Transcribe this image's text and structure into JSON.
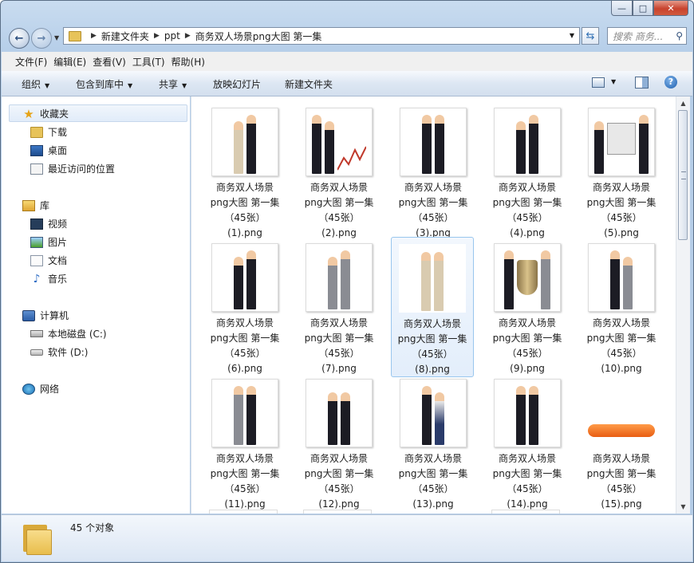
{
  "window": {
    "caption_buttons": {
      "minimize": "—",
      "maximize": "□",
      "close": "✕"
    }
  },
  "address": {
    "crumbs": [
      "新建文件夹",
      "ppt",
      "商务双人场景png大图 第一集"
    ],
    "search_placeholder": "搜索 商务..."
  },
  "menu": [
    "文件(F)",
    "编辑(E)",
    "查看(V)",
    "工具(T)",
    "帮助(H)"
  ],
  "commands": {
    "organize": "组织",
    "include_in_library": "包含到库中",
    "share": "共享",
    "slideshow": "放映幻灯片",
    "new_folder": "新建文件夹"
  },
  "nav": {
    "favorites": "收藏夹",
    "downloads": "下载",
    "desktop": "桌面",
    "recent": "最近访问的位置",
    "libraries": "库",
    "videos": "视频",
    "pictures": "图片",
    "documents": "文档",
    "music": "音乐",
    "computer": "计算机",
    "drive_c": "本地磁盘 (C:)",
    "drive_d": "软件 (D:)",
    "network": "网络"
  },
  "files": [
    {
      "line1": "商务双人场景",
      "line2": "png大图 第一集",
      "line3": "（45张）",
      "line4": "(1).png"
    },
    {
      "line1": "商务双人场景",
      "line2": "png大图 第一集",
      "line3": "（45张）",
      "line4": "(2).png"
    },
    {
      "line1": "商务双人场景",
      "line2": "png大图 第一集",
      "line3": "（45张）",
      "line4": "(3).png"
    },
    {
      "line1": "商务双人场景",
      "line2": "png大图 第一集",
      "line3": "（45张）",
      "line4": "(4).png"
    },
    {
      "line1": "商务双人场景",
      "line2": "png大图 第一集",
      "line3": "（45张）",
      "line4": "(5).png"
    },
    {
      "line1": "商务双人场景",
      "line2": "png大图 第一集",
      "line3": "（45张）",
      "line4": "(6).png"
    },
    {
      "line1": "商务双人场景",
      "line2": "png大图 第一集",
      "line3": "（45张）",
      "line4": "(7).png"
    },
    {
      "line1": "商务双人场景",
      "line2": "png大图 第一集",
      "line3": "（45张）",
      "line4": "(8).png"
    },
    {
      "line1": "商务双人场景",
      "line2": "png大图 第一集",
      "line3": "（45张）",
      "line4": "(9).png"
    },
    {
      "line1": "商务双人场景",
      "line2": "png大图 第一集",
      "line3": "（45张）",
      "line4": "(10).png"
    },
    {
      "line1": "商务双人场景",
      "line2": "png大图 第一集",
      "line3": "（45张）",
      "line4": "(11).png"
    },
    {
      "line1": "商务双人场景",
      "line2": "png大图 第一集",
      "line3": "（45张）",
      "line4": "(12).png"
    },
    {
      "line1": "商务双人场景",
      "line2": "png大图 第一集",
      "line3": "（45张）",
      "line4": "(13).png"
    },
    {
      "line1": "商务双人场景",
      "line2": "png大图 第一集",
      "line3": "（45张）",
      "line4": "(14).png"
    },
    {
      "line1": "商务双人场景",
      "line2": "png大图 第一集",
      "line3": "（45张）",
      "line4": "(15).png"
    }
  ],
  "status": {
    "count": "45 个对象"
  }
}
